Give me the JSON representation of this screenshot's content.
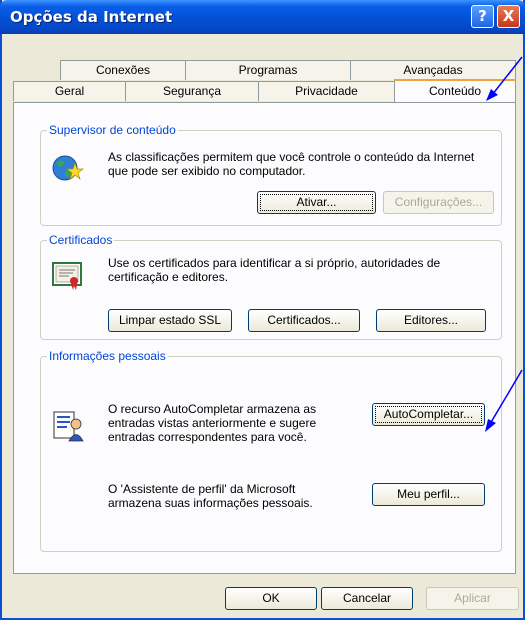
{
  "window": {
    "title": "Opções da Internet",
    "help_glyph": "?",
    "close_glyph": "X"
  },
  "tabs_row1": [
    "Conexões",
    "Programas",
    "Avançadas"
  ],
  "tabs_row2": [
    "Geral",
    "Segurança",
    "Privacidade",
    "Conteúdo"
  ],
  "active_tab": "Conteúdo",
  "content_advisor": {
    "title": "Supervisor de conteúdo",
    "icon": "globe-star-icon",
    "description": "As classificações permitem que você controle o conteúdo da Internet que pode ser exibido no computador.",
    "enable_label": "Ativar...",
    "settings_label": "Configurações..."
  },
  "certificates": {
    "title": "Certificados",
    "icon": "certificate-icon",
    "description": "Use os certificados para identificar a si próprio, autoridades de certificação e editores.",
    "clear_ssl_label": "Limpar estado SSL",
    "certificates_label": "Certificados...",
    "publishers_label": "Editores..."
  },
  "personal_info": {
    "title": "Informações pessoais",
    "icon": "autocomplete-icon",
    "autocomplete_description": "O recurso AutoCompletar armazena as entradas vistas anteriormente e sugere entradas correspondentes para você.",
    "autocomplete_label": "AutoCompletar...",
    "profile_description": "O 'Assistente de perfil' da Microsoft armazena suas informações pessoais.",
    "profile_label": "Meu perfil..."
  },
  "footer": {
    "ok_label": "OK",
    "cancel_label": "Cancelar",
    "apply_label": "Aplicar"
  },
  "colors": {
    "titlebar": "#0350d5",
    "group_title": "#0046d5",
    "annotation_arrow": "#0000ff",
    "active_tab_highlight": "#f1a33b"
  }
}
